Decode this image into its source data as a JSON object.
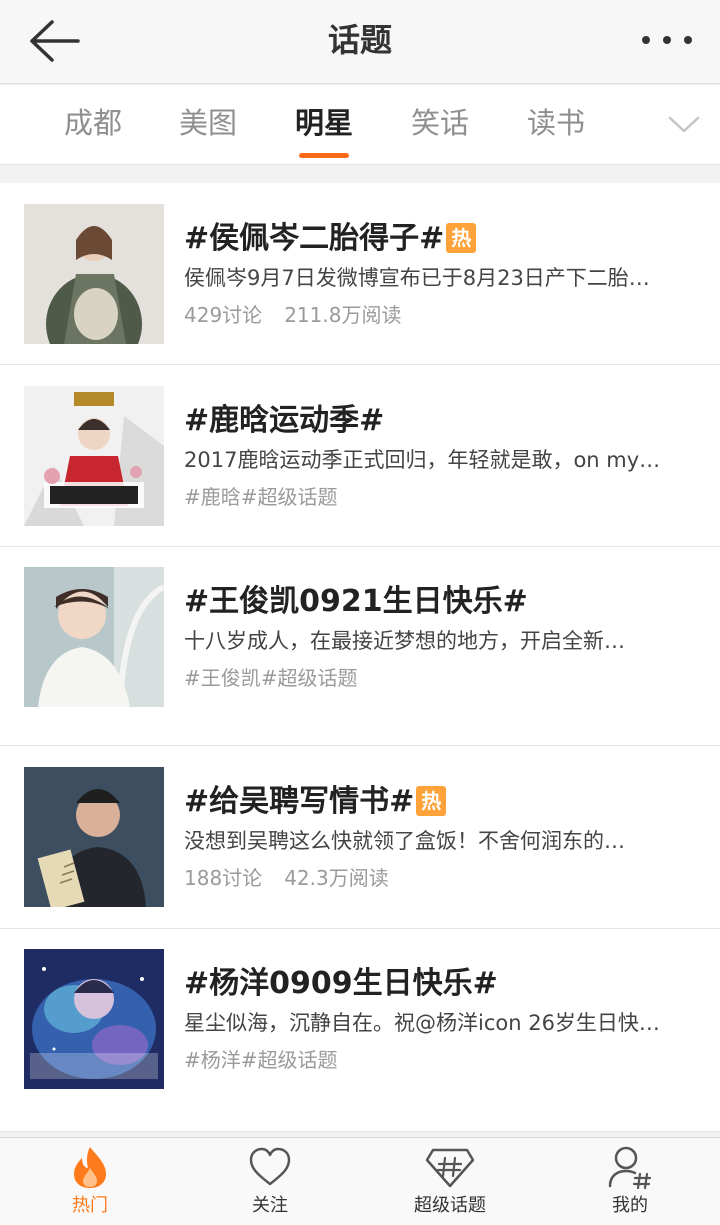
{
  "header": {
    "title": "话题",
    "back_icon": "arrow-left-icon",
    "more_icon": "more-dots-icon"
  },
  "tabs": [
    {
      "label": "成都",
      "active": false
    },
    {
      "label": "美图",
      "active": false
    },
    {
      "label": "明星",
      "active": true
    },
    {
      "label": "笑话",
      "active": false
    },
    {
      "label": "读书",
      "active": false
    }
  ],
  "tabs_expand_icon": "chevron-down-icon",
  "hot_badge": "热",
  "topics": [
    {
      "title": "#侯佩岑二胎得子#",
      "hot": true,
      "desc": "侯佩岑9月7日发微博宣布已于8月23日产下二胎…",
      "discussions": "429讨论",
      "reads": "211.8万阅读"
    },
    {
      "title": "#鹿晗运动季#",
      "hot": false,
      "desc": "2017鹿晗运动季正式回归，年轻就是敢，on my…",
      "tags": "#鹿晗#超级话题"
    },
    {
      "title": "#王俊凯0921生日快乐#",
      "hot": false,
      "desc": "十八岁成人，在最接近梦想的地方，开启全新…",
      "tags": "#王俊凯#超级话题"
    },
    {
      "title": "#给吴聘写情书#",
      "hot": true,
      "desc": "没想到吴聘这么快就领了盒饭！不舍何润东的…",
      "discussions": "188讨论",
      "reads": "42.3万阅读"
    },
    {
      "title": "#杨洋0909生日快乐#",
      "hot": false,
      "desc": "星尘似海，沉静自在。祝@杨洋icon 26岁生日快…",
      "tags": "#杨洋#超级话题"
    }
  ],
  "bottom_nav": [
    {
      "label": "热门",
      "icon": "flame-icon",
      "active": true,
      "color": "#ff7a1a"
    },
    {
      "label": "关注",
      "icon": "heart-icon",
      "active": false
    },
    {
      "label": "超级话题",
      "icon": "hash-diamond-icon",
      "active": false
    },
    {
      "label": "我的",
      "icon": "user-hash-icon",
      "active": false
    }
  ]
}
